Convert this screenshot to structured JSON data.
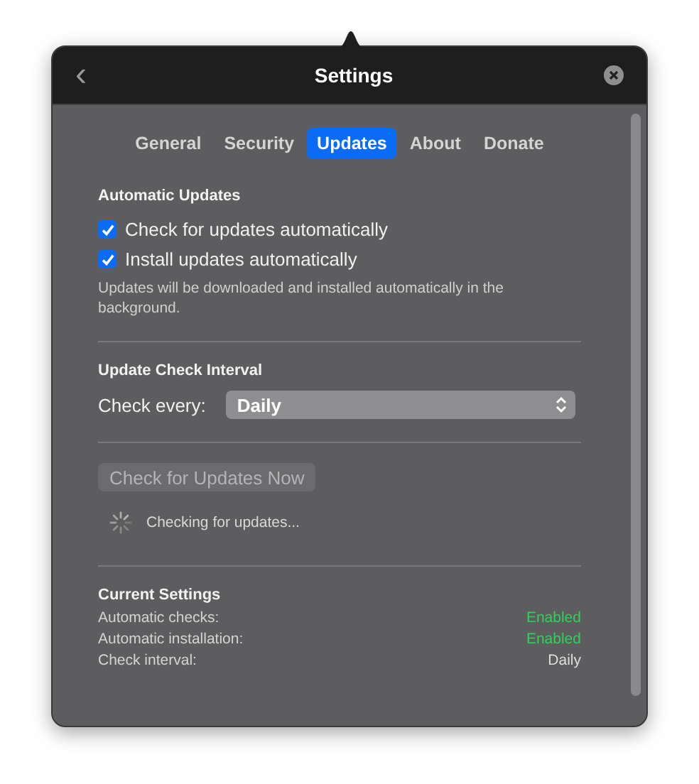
{
  "window": {
    "title": "Settings",
    "back": "‹"
  },
  "tabs": [
    {
      "label": "General",
      "selected": false
    },
    {
      "label": "Security",
      "selected": false
    },
    {
      "label": "Updates",
      "selected": true
    },
    {
      "label": "About",
      "selected": false
    },
    {
      "label": "Donate",
      "selected": false
    }
  ],
  "automatic_updates": {
    "heading": "Automatic Updates",
    "options": [
      {
        "label": "Check for updates automatically",
        "checked": true
      },
      {
        "label": "Install updates automatically",
        "checked": true
      }
    ],
    "description": "Updates will be downloaded and installed automatically in the background."
  },
  "interval": {
    "heading": "Update Check Interval",
    "label": "Check every:",
    "value": "Daily"
  },
  "check_now": {
    "label": "Check for Updates Now",
    "disabled": true,
    "status": "Checking for updates..."
  },
  "current_settings": {
    "heading": "Current Settings",
    "rows": [
      {
        "label": "Automatic checks:",
        "value": "Enabled",
        "color": "#30d158"
      },
      {
        "label": "Automatic installation:",
        "value": "Enabled",
        "color": "#30d158"
      },
      {
        "label": "Check interval:",
        "value": "Daily",
        "color": "#dddddd"
      }
    ]
  }
}
